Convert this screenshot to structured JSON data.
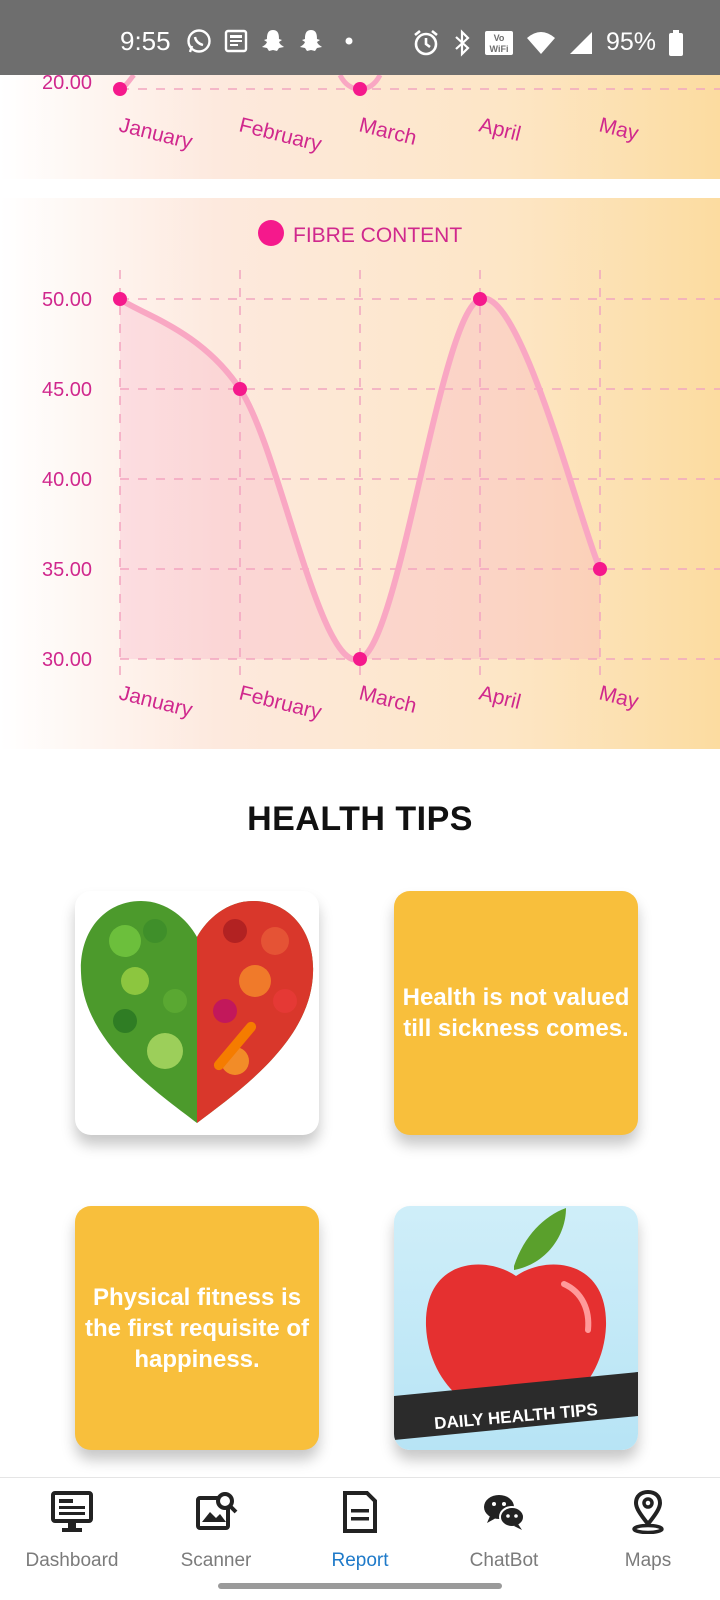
{
  "status_bar": {
    "time": "9:55",
    "battery": "95%",
    "icons_left": [
      "whatsapp-icon",
      "news-icon",
      "snapchat-icon",
      "snapchat-icon",
      "dot-icon"
    ],
    "icons_right": [
      "alarm-icon",
      "bluetooth-icon",
      "vowifi-icon",
      "wifi-icon",
      "signal-icon",
      "battery-icon"
    ]
  },
  "top_chart": {
    "visible_tick": "20.00",
    "months": [
      "January",
      "February",
      "March",
      "April",
      "May"
    ]
  },
  "chart_data": {
    "type": "line",
    "legend": "FIBRE CONTENT",
    "categories": [
      "January",
      "February",
      "March",
      "April",
      "May"
    ],
    "values": [
      50,
      45,
      30,
      50,
      35
    ],
    "y_ticks": [
      "50.00",
      "45.00",
      "40.00",
      "35.00",
      "30.00"
    ],
    "ylim": [
      30,
      50
    ],
    "color": "#f5198c",
    "line_color": "#f9a7c3",
    "grid": true,
    "legend_position": "top"
  },
  "health_tips": {
    "title": "HEALTH TIPS",
    "tip1": "Health is not valued till sickness comes.",
    "tip2": "Physical fitness is the first requisite of happiness.",
    "banner": "DAILY HEALTH TIPS"
  },
  "bottom_nav": {
    "items": [
      {
        "label": "Dashboard",
        "icon": "dashboard-icon"
      },
      {
        "label": "Scanner",
        "icon": "scanner-icon"
      },
      {
        "label": "Report",
        "icon": "report-icon"
      },
      {
        "label": "ChatBot",
        "icon": "chatbot-icon"
      },
      {
        "label": "Maps",
        "icon": "maps-icon"
      }
    ],
    "active": "Report",
    "active_color": "#1f7ac9"
  }
}
